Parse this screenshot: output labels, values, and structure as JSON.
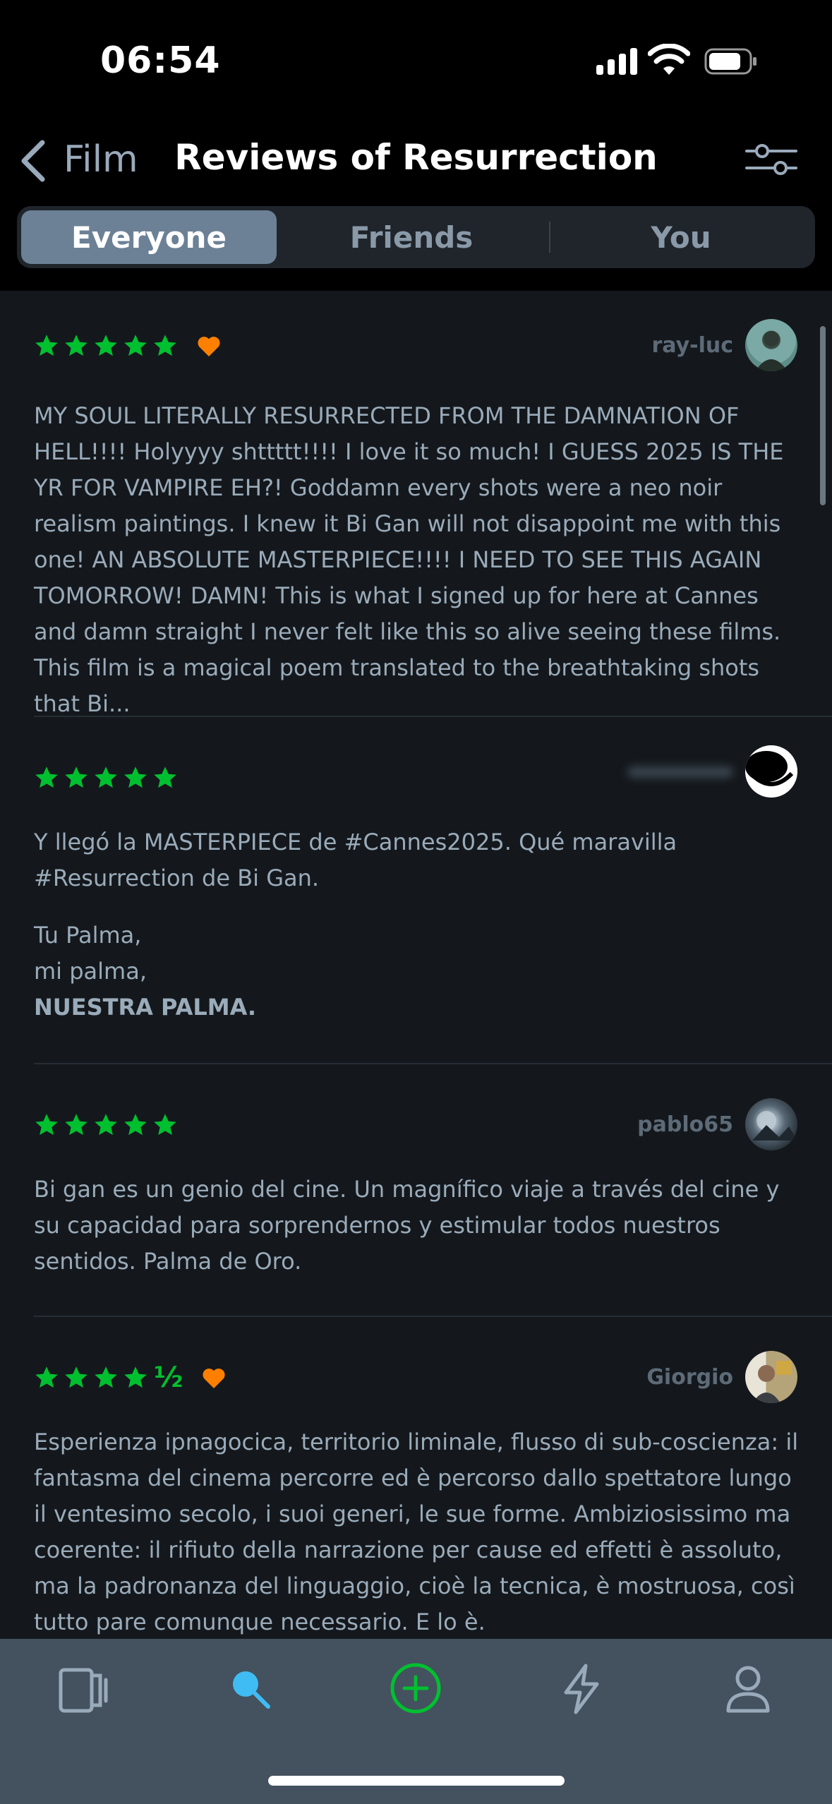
{
  "status_bar": {
    "time": "06:54"
  },
  "header": {
    "back_label": "Film",
    "title": "Reviews of Resurrection"
  },
  "segments": [
    {
      "label": "Everyone",
      "active": true
    },
    {
      "label": "Friends",
      "active": false
    },
    {
      "label": "You",
      "active": false
    }
  ],
  "reviews": [
    {
      "rating": "5 stars",
      "liked": true,
      "username": "ray-luc",
      "text": "MY SOUL LITERALLY RESURRECTED FROM THE DAMNATION OF HELL!!!! Holyyyy shttttt!!!! I love it so much! I GUESS 2025 IS THE YR FOR VAMPIRE EH?! Goddamn every shots were a neo noir realism paintings. I knew it Bi Gan will not disappoint me with this one! AN ABSOLUTE MASTERPIECE!!!! I NEED TO SEE THIS AGAIN TOMORROW! DAMN! This is what I signed up for here at Cannes and damn straight I never felt like this so alive seeing these films. This film is a magical poem translated to the breathtaking shots that Bi..."
    },
    {
      "rating": "5 stars",
      "liked": false,
      "username": "",
      "text": "Y llegó la MASTERPIECE de #Cannes2025. Qué maravilla #Resurrection de Bi Gan.",
      "lines": [
        "Tu Palma,",
        "mi palma,"
      ],
      "bold_line": "NUESTRA PALMA."
    },
    {
      "rating": "5 stars",
      "liked": false,
      "username": "pablo65",
      "text": "Bi gan es un genio del cine. Un magnífico viaje a través del cine y su capacidad para sorprendernos y estimular todos nuestros sentidos. Palma de Oro."
    },
    {
      "rating": "4.5 stars",
      "half_symbol": "½",
      "liked": true,
      "username": "Giorgio",
      "text": "Esperienza ipnagocica, territorio liminale, flusso di sub-coscienza: il fantasma del cinema percorre ed è percorso dallo spettatore lungo il ventesimo secolo, i suoi generi, le sue forme. Ambiziosissimo ma coerente: il rifiuto della narrazione per cause ed effetti è assoluto, ma la padronanza del linguaggio, cioè la tecnica, è mostruosa, così tutto pare comunque necessario. E lo è."
    }
  ],
  "colors": {
    "star": "#00c030",
    "heart": "#ff8000",
    "tab_active": "#40bcf4",
    "add_button": "#00c030"
  },
  "tab_bar": {
    "icons": [
      "films-icon",
      "search-icon",
      "add-icon",
      "activity-icon",
      "profile-icon"
    ],
    "active": "search-icon"
  }
}
